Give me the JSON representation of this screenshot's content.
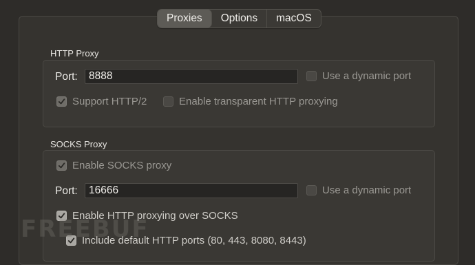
{
  "tabs": [
    {
      "label": "Proxies",
      "active": true
    },
    {
      "label": "Options",
      "active": false
    },
    {
      "label": "macOS",
      "active": false
    }
  ],
  "http_proxy": {
    "title": "HTTP Proxy",
    "port_label": "Port:",
    "port_value": "8888",
    "dynamic_port_label": "Use a dynamic port",
    "dynamic_port_checked": false,
    "support_http2_label": "Support HTTP/2",
    "support_http2_checked": true,
    "transparent_label": "Enable transparent HTTP proxying",
    "transparent_checked": false
  },
  "socks_proxy": {
    "title": "SOCKS Proxy",
    "enable_label": "Enable SOCKS proxy",
    "enable_checked": true,
    "port_label": "Port:",
    "port_value": "16666",
    "dynamic_port_label": "Use a dynamic port",
    "dynamic_port_checked": false,
    "http_over_socks_label": "Enable HTTP proxying over SOCKS",
    "http_over_socks_checked": true,
    "default_ports_label": "Include default HTTP ports (80, 443, 8080, 8443)",
    "default_ports_checked": true
  },
  "watermark": "FREEBUF",
  "colors": {
    "background": "#2e2c29",
    "panel": "#35332f",
    "active_tab": "#5d5b56"
  }
}
